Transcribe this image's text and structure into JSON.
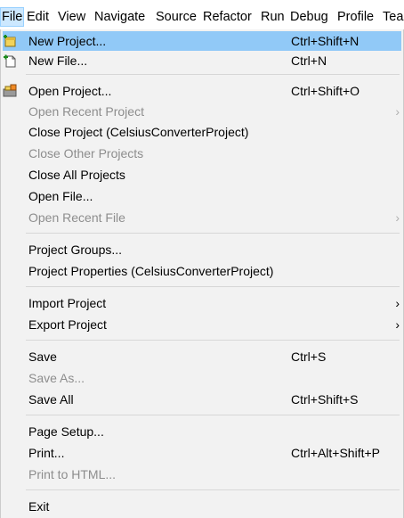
{
  "menubar": {
    "items": [
      "File",
      "Edit",
      "View",
      "Navigate",
      "Source",
      "Refactor",
      "Run",
      "Debug",
      "Profile",
      "Tea"
    ]
  },
  "menu": {
    "new_project": {
      "label": "New Project...",
      "shortcut": "Ctrl+Shift+N",
      "icon": "new-project-icon"
    },
    "new_file": {
      "label": "New File...",
      "shortcut": "Ctrl+N",
      "icon": "new-file-icon"
    },
    "open_project": {
      "label": "Open Project...",
      "shortcut": "Ctrl+Shift+O",
      "icon": "open-project-icon"
    },
    "open_recent_project": {
      "label": "Open Recent Project",
      "arrow": "›"
    },
    "close_project": {
      "label": "Close Project (CelsiusConverterProject)"
    },
    "close_other_projects": {
      "label": "Close Other Projects"
    },
    "close_all_projects": {
      "label": "Close All Projects"
    },
    "open_file": {
      "label": "Open File..."
    },
    "open_recent_file": {
      "label": "Open Recent File",
      "arrow": "›"
    },
    "project_groups": {
      "label": "Project Groups..."
    },
    "project_properties": {
      "label": "Project Properties (CelsiusConverterProject)"
    },
    "import_project": {
      "label": "Import Project",
      "arrow": "›"
    },
    "export_project": {
      "label": "Export Project",
      "arrow": "›"
    },
    "save": {
      "label": "Save",
      "shortcut": "Ctrl+S"
    },
    "save_as": {
      "label": "Save As..."
    },
    "save_all": {
      "label": "Save All",
      "shortcut": "Ctrl+Shift+S"
    },
    "page_setup": {
      "label": "Page Setup..."
    },
    "print": {
      "label": "Print...",
      "shortcut": "Ctrl+Alt+Shift+P"
    },
    "print_to_html": {
      "label": "Print to HTML..."
    },
    "exit": {
      "label": "Exit"
    }
  },
  "colors": {
    "highlight": "#91c9f7",
    "menubar_active": "#cce8ff",
    "disabled_text": "#8d8d8d",
    "menu_background": "#f2f2f2"
  }
}
